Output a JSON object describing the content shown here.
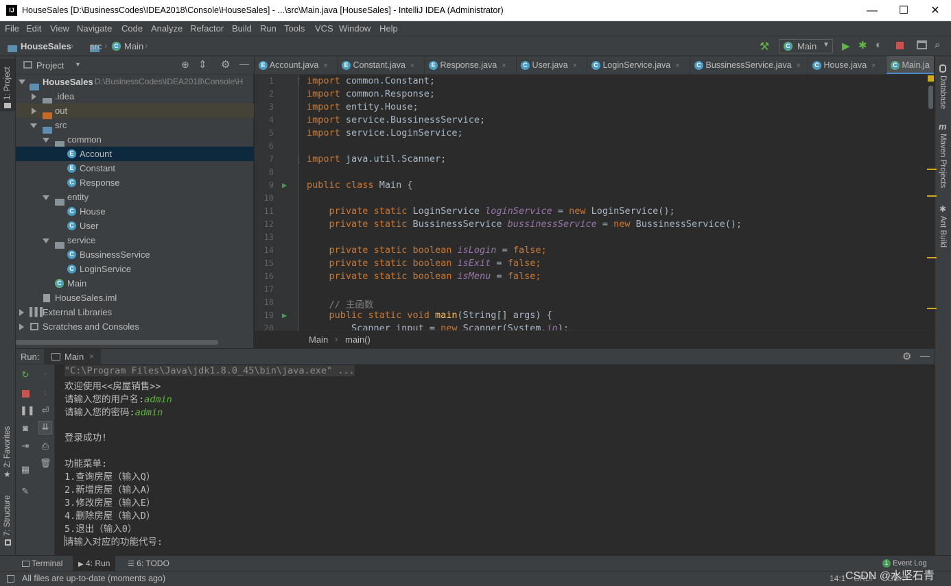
{
  "window": {
    "title": "HouseSales [D:\\BusinessCodes\\IDEA2018\\Console\\HouseSales] - ...\\src\\Main.java [HouseSales] - IntelliJ IDEA (Administrator)",
    "app_icon": "IJ",
    "minimize": "—",
    "maximize": "☐",
    "close": "✕"
  },
  "menu": [
    "File",
    "Edit",
    "View",
    "Navigate",
    "Code",
    "Analyze",
    "Refactor",
    "Build",
    "Run",
    "Tools",
    "VCS",
    "Window",
    "Help"
  ],
  "navbar": {
    "project": "HouseSales",
    "folder": "src",
    "file": "Main",
    "run_config": "Main"
  },
  "left_stripe": {
    "project": "1: Project",
    "favorites": "2: Favorites",
    "structure": "7: Structure"
  },
  "right_stripe": {
    "database": "Database",
    "maven": "Maven Projects",
    "ant": "Ant Build",
    "maven_glyph": "m"
  },
  "project_panel": {
    "title": "Project",
    "tree": [
      {
        "label": "HouseSales",
        "extra": "D:\\BusinessCodes\\IDEA2018\\Console\\H"
      },
      {
        "label": ".idea"
      },
      {
        "label": "out"
      },
      {
        "label": "src"
      },
      {
        "label": "common"
      },
      {
        "label": "Account"
      },
      {
        "label": "Constant"
      },
      {
        "label": "Response"
      },
      {
        "label": "entity"
      },
      {
        "label": "House"
      },
      {
        "label": "User"
      },
      {
        "label": "service"
      },
      {
        "label": "BussinessService"
      },
      {
        "label": "LoginService"
      },
      {
        "label": "Main"
      },
      {
        "label": "HouseSales.iml"
      },
      {
        "label": "External Libraries"
      },
      {
        "label": "Scratches and Consoles"
      }
    ]
  },
  "tabs": [
    {
      "label": "Account.java",
      "icon": "E"
    },
    {
      "label": "Constant.java",
      "icon": "E"
    },
    {
      "label": "Response.java",
      "icon": "E"
    },
    {
      "label": "User.java",
      "icon": "C"
    },
    {
      "label": "LoginService.java",
      "icon": "C"
    },
    {
      "label": "BussinessService.java",
      "icon": "C"
    },
    {
      "label": "House.java",
      "icon": "C"
    },
    {
      "label": "Main.ja",
      "icon": "C"
    }
  ],
  "tab_close": "×",
  "editor": {
    "line_numbers": [
      "1",
      "2",
      "3",
      "4",
      "5",
      "6",
      "7",
      "8",
      "9",
      "10",
      "11",
      "12",
      "13",
      "14",
      "15",
      "16",
      "17",
      "18",
      "19",
      "20"
    ],
    "breadcrumb": [
      "Main",
      "main()"
    ],
    "tokens": {
      "import": "import",
      "imp1": "common.Constant;",
      "imp2": "common.Response;",
      "imp3": "entity.House;",
      "imp4": "service.BussinessService;",
      "imp5": "service.LoginService;",
      "imp7": "java.util.Scanner;",
      "public": "public",
      "class": "class",
      "class_name": "Main {",
      "private": "private",
      "static": "static",
      "type_login": "LoginService",
      "var_login": "loginService",
      "eq": "=",
      "new": "new",
      "ctor_login": "LoginService();",
      "type_biz": "BussinessService",
      "var_biz": "bussinessService",
      "ctor_biz": "BussinessService();",
      "boolean": "boolean",
      "var_islogin": "isLogin",
      "var_isexit": "isExit",
      "var_ismenu": "isMenu",
      "false": "false",
      "semi": ";",
      "comment": "// 主函数",
      "void": "void",
      "main": "main",
      "main_args": "(String[] args) {",
      "line20a": "Scanner input =",
      "line20b": "Scanner(System.",
      "line20c": "in",
      "line20d": ");"
    }
  },
  "run_panel": {
    "label": "Run:",
    "tab": "Main",
    "tab_close": "×",
    "console": {
      "cmd": "\"C:\\Program Files\\Java\\jdk1.8.0_45\\bin\\java.exe\" ...",
      "welcome": "欢迎使用<<房屋销售>>",
      "prompt_user": "请输入您的用户名:",
      "input_user": "admin",
      "prompt_pwd": "请输入您的密码:",
      "input_pwd": "admin",
      "login_ok": "登录成功!",
      "menu_title": "功能菜单:",
      "menu_1": "1.查询房屋（输入Q）",
      "menu_2": "2.新增房屋（输入A）",
      "menu_3": "3.修改房屋（输入E）",
      "menu_4": "4.删除房屋（输入D）",
      "menu_5": "5.退出（输入0）",
      "prompt_code": "请输入对应的功能代号:"
    }
  },
  "bottom_tools": {
    "terminal": "Terminal",
    "run": "4: Run",
    "todo": "6: TODO",
    "event_log": "Event Log",
    "event_count": "1"
  },
  "status_bar": {
    "message": "All files are up-to-date (moments ago)",
    "position": "14:1",
    "line_sep": "CRLF",
    "encoding": "GBK",
    "watermark": "CSDN @水坚石青"
  },
  "colors": {
    "accent": "#4a88c7",
    "keyword": "#cc7832",
    "field": "#9876aa",
    "run_green": "#62b543",
    "stop_red": "#c75450"
  }
}
